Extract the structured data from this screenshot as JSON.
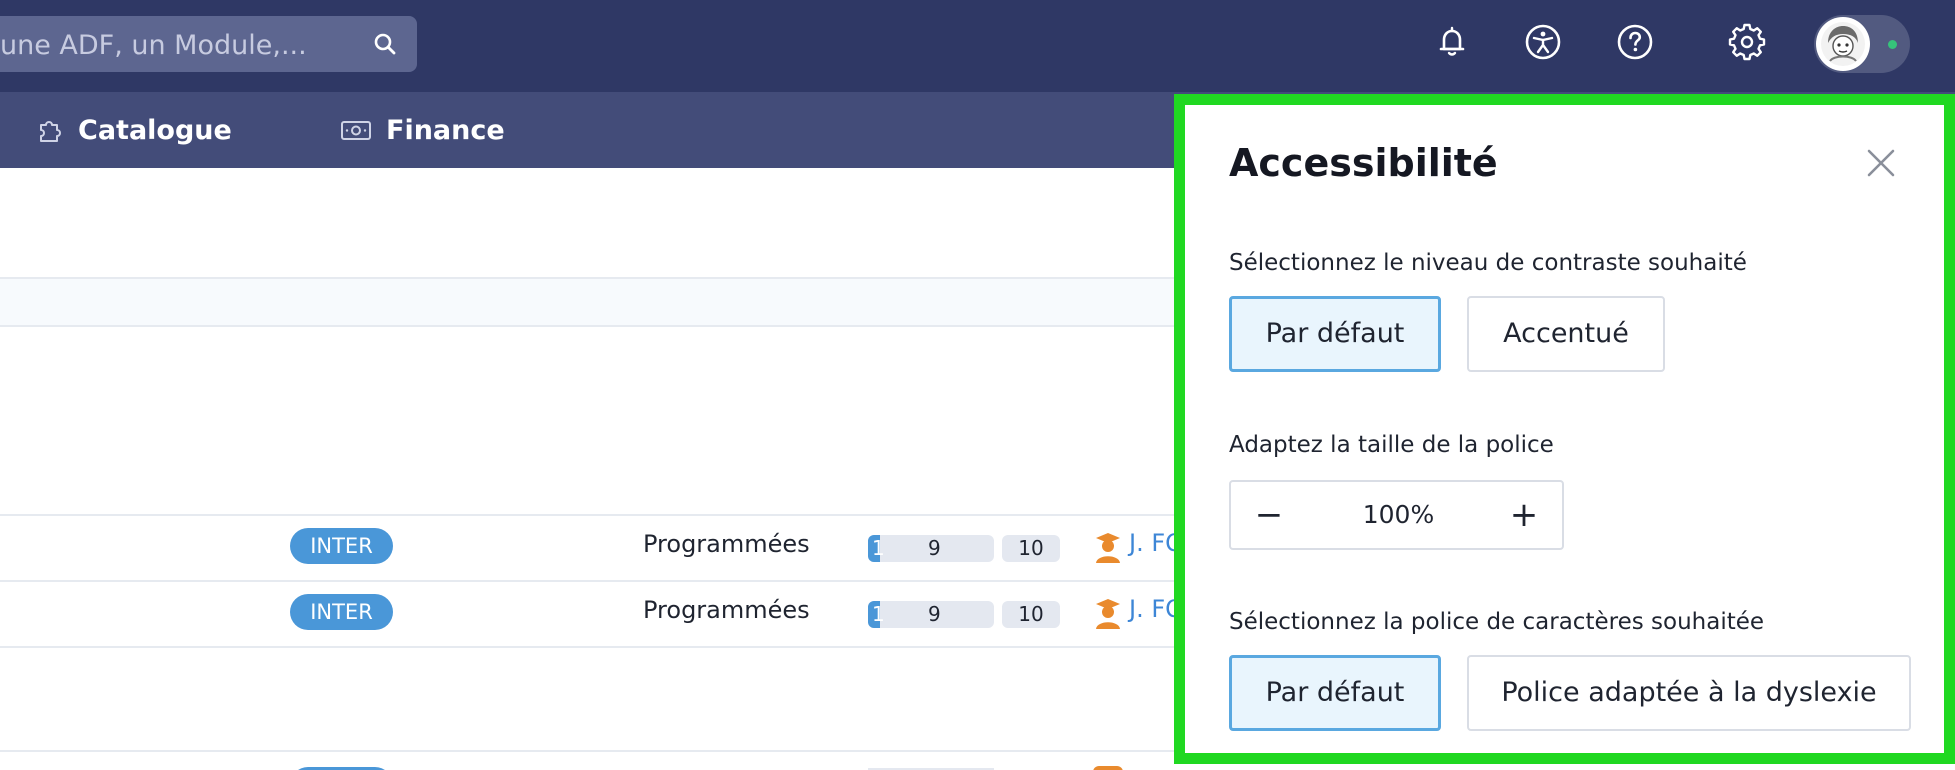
{
  "header": {
    "search_text": "une ADF, un Module,...",
    "icons": [
      "bell-icon",
      "accessibility-icon",
      "help-icon",
      "gear-icon",
      "avatar"
    ],
    "colors": {
      "topbar": "#2f3865",
      "navbar": "#434c79",
      "accent": "#4a97d8",
      "highlight_border": "#20d821"
    }
  },
  "nav": {
    "items": [
      {
        "label": "Catalogue",
        "icon": "puzzle-icon"
      },
      {
        "label": "Finance",
        "icon": "banknote-icon"
      }
    ]
  },
  "table": {
    "rows": [
      {
        "type": "INTER",
        "status": "Programmées",
        "progress_value": "1",
        "progress_total": "9",
        "count": "10",
        "trainer": "J. FO"
      },
      {
        "type": "INTER",
        "status": "Programmées",
        "progress_value": "1",
        "progress_total": "9",
        "count": "10",
        "trainer": "J. FO"
      }
    ]
  },
  "accessibility_panel": {
    "title": "Accessibilité",
    "contrast": {
      "label": "Sélectionnez le niveau de contraste souhaité",
      "options": [
        "Par défaut",
        "Accentué"
      ],
      "selected": "Par défaut"
    },
    "font_size": {
      "label": "Adaptez la taille de la police",
      "minus": "−",
      "value": "100%",
      "plus": "+"
    },
    "font": {
      "label": "Sélectionnez la police de caractères souhaitée",
      "options": [
        "Par défaut",
        "Police adaptée à la dyslexie"
      ],
      "selected": "Par défaut"
    }
  }
}
